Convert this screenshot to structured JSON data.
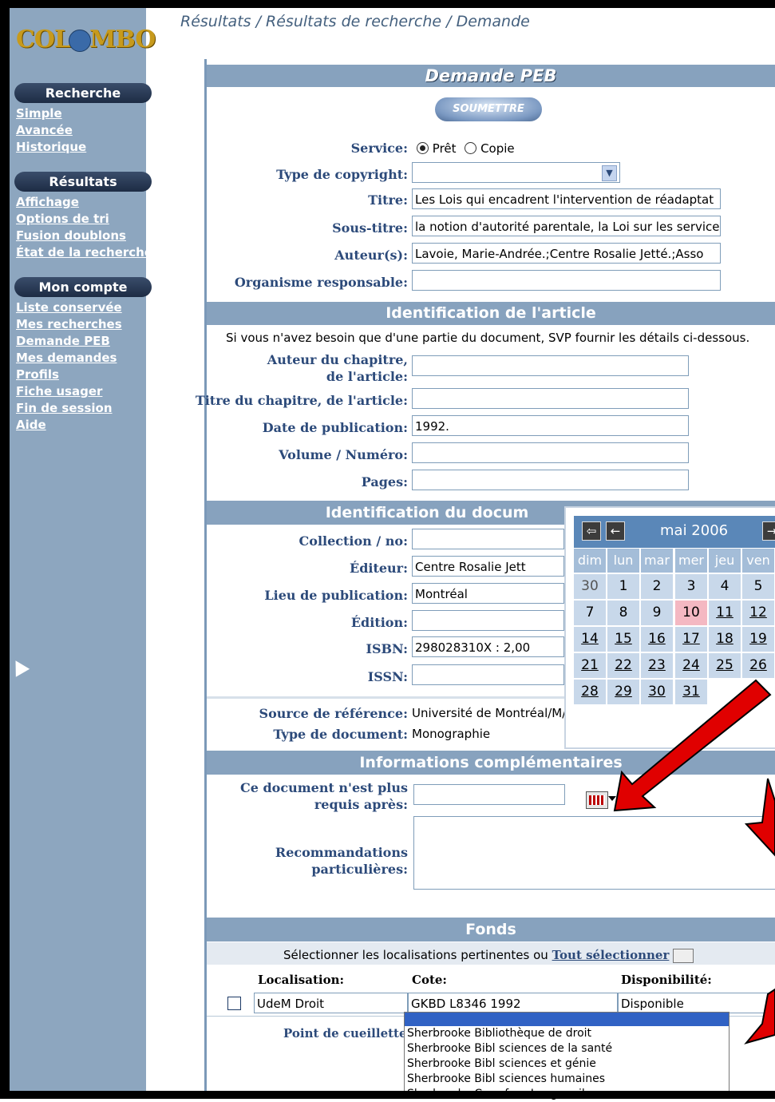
{
  "breadcrumb": "Résultats / Résultats de recherche / Demande",
  "logo": "COLOMBO",
  "sidebar": {
    "sections": [
      {
        "title": "Recherche",
        "links": [
          "Simple",
          "Avancée",
          "Historique"
        ]
      },
      {
        "title": "Résultats",
        "links": [
          "Affichage",
          "Options de tri",
          "Fusion doublons",
          "État de la recherche"
        ]
      },
      {
        "title": "Mon compte",
        "links": [
          "Liste conservée",
          "Mes recherches",
          "Demande PEB",
          "Mes demandes",
          "Profils",
          "Fiche usager",
          "Fin de session",
          "Aide"
        ]
      }
    ]
  },
  "form": {
    "title": "Demande PEB",
    "submit": "SOUMETTRE",
    "service_label": "Service:",
    "service_options": [
      "Prêt",
      "Copie"
    ],
    "service_selected": "Prêt",
    "copyright_label": "Type de copyright:",
    "copyright_value": "",
    "titre_label": "Titre:",
    "titre_value": "Les Lois qui encadrent l'intervention de réadaptat",
    "soustitre_label": "Sous-titre:",
    "soustitre_value": "la notion d'autorité parentale, la Loi sur les service",
    "auteurs_label": "Auteur(s):",
    "auteurs_value": "Lavoie, Marie-Andrée.;Centre Rosalie Jetté.;Asso",
    "organisme_label": "Organisme responsable:",
    "organisme_value": ""
  },
  "article": {
    "header": "Identification de l'article",
    "note": "Si vous n'avez besoin que d'une partie du document, SVP fournir les détails ci-dessous.",
    "auteur_chapitre_label": "Auteur du chapitre, de l'article:",
    "titre_chapitre_label": "Titre du chapitre, de l'article:",
    "date_label": "Date de publication:",
    "date_value": "1992.",
    "volume_label": "Volume / Numéro:",
    "pages_label": "Pages:"
  },
  "document": {
    "header": "Identification du docum",
    "collection_label": "Collection / no:",
    "editeur_label": "Éditeur:",
    "editeur_value": "Centre Rosalie Jett",
    "lieu_label": "Lieu de publication:",
    "lieu_value": "Montréal",
    "edition_label": "Édition:",
    "isbn_label": "ISBN:",
    "isbn_value": "298028310X : 2,00",
    "issn_label": "ISSN:",
    "source_label": "Source de référence:",
    "source_value": "Université de Montréal/M/",
    "type_label": "Type de document:",
    "type_value": "Monographie"
  },
  "complement": {
    "header": "Informations complémentaires",
    "requis_label": "Ce document n'est plus requis après:",
    "recommandations_label": "Recommandations particulières:"
  },
  "fonds": {
    "header": "Fonds",
    "instruction": "Sélectionner les localisations pertinentes ou",
    "select_all": "Tout sélectionner",
    "columns": [
      "Localisation:",
      "Cote:",
      "Disponibilité:"
    ],
    "rows": [
      {
        "localisation": "UdeM Droit",
        "cote": "GKBD L8346 1992",
        "disponibilite": "Disponible"
      }
    ],
    "point_label": "Point de cueillette"
  },
  "dropdown_options": [
    "Sherbrooke Bibliothèque de droit",
    "Sherbrooke Bibl sciences de la santé",
    "Sherbrooke Bibl sciences et génie",
    "Sherbrooke Bibl sciences humaines",
    "Sherbrooke Carrefour Longueuil"
  ],
  "calendar": {
    "month": "mai 2006",
    "days_of_week": [
      "dim",
      "lun",
      "mar",
      "mer",
      "jeu",
      "ven"
    ],
    "weeks": [
      [
        "30",
        "1",
        "2",
        "3",
        "4",
        "5"
      ],
      [
        "7",
        "8",
        "9",
        "10",
        "11",
        "12"
      ],
      [
        "14",
        "15",
        "16",
        "17",
        "18",
        "19"
      ],
      [
        "21",
        "22",
        "23",
        "24",
        "25",
        "26"
      ],
      [
        "28",
        "29",
        "30",
        "31",
        "",
        ""
      ]
    ],
    "today": "10",
    "nav_prev_year": "⇦",
    "nav_prev_month": "←",
    "nav_next": "→"
  },
  "colors": {
    "sidebar": "#8da6bf",
    "header_bar": "#87a2be",
    "label": "#2c4a7a",
    "arrow": "#e00000"
  }
}
